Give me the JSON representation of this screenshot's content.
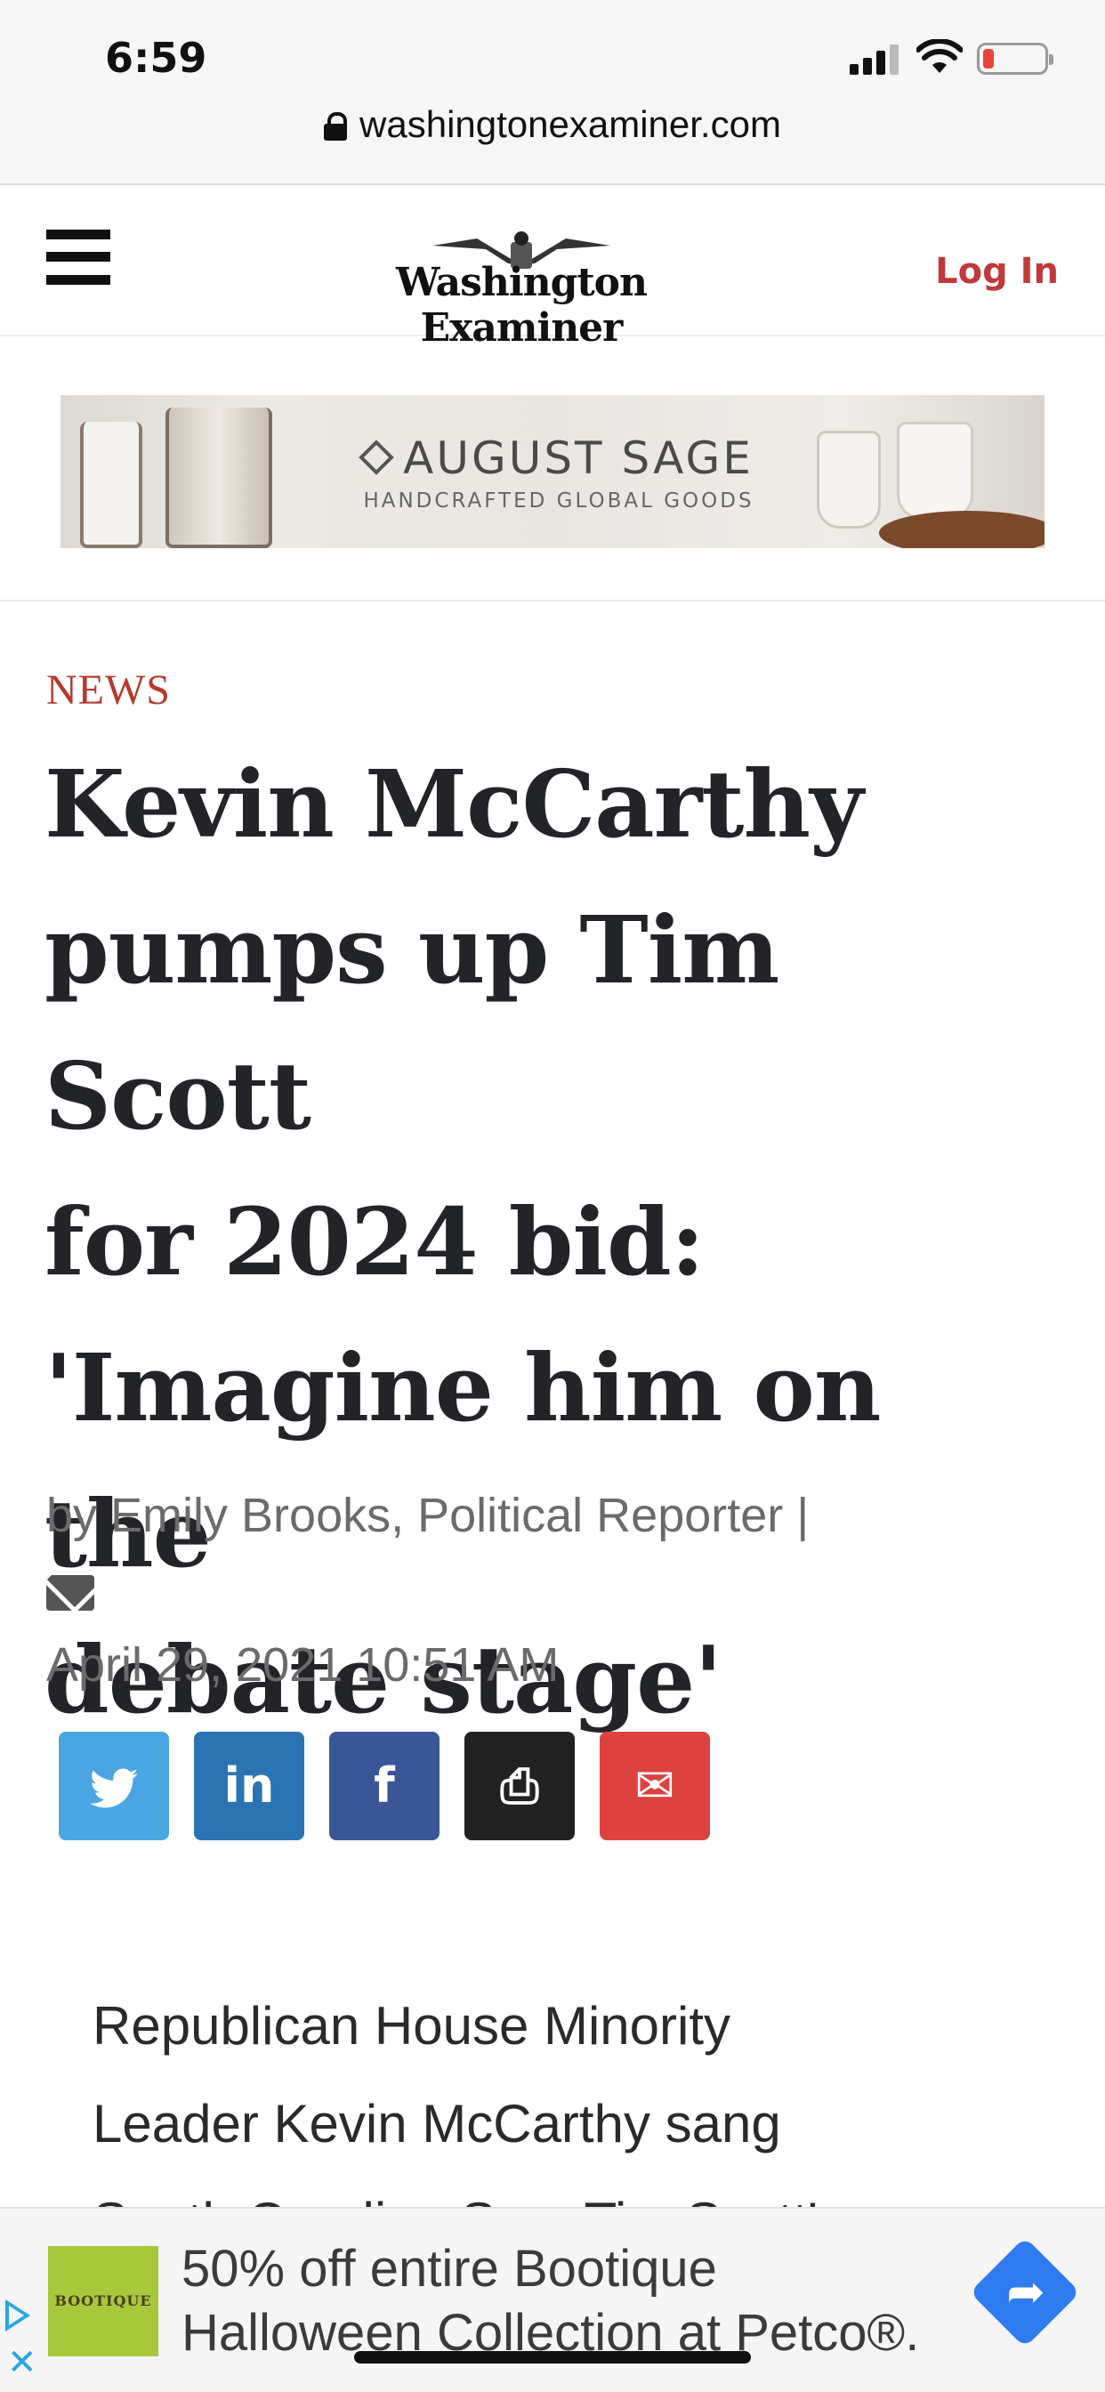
{
  "status_bar": {
    "time": "6:59",
    "url": "washingtonexaminer.com"
  },
  "header": {
    "logo_text": "Washington Examiner",
    "login_label": "Log In"
  },
  "top_ad": {
    "title": "AUGUST SAGE",
    "subtitle": "HANDCRAFTED GLOBAL GOODS"
  },
  "article": {
    "section": "NEWS",
    "headline_lines": [
      "Kevin McCarthy",
      "pumps up Tim Scott",
      "for 2024 bid:",
      "'Imagine him on the",
      "debate stage'"
    ],
    "byline": "by Emily Brooks, Political Reporter |",
    "date": "April 29, 2021 10:51 AM",
    "share_buttons": [
      {
        "name": "twitter",
        "glyph": "t",
        "color": "#4aa6e3"
      },
      {
        "name": "linkedin",
        "glyph": "in",
        "color": "#2a74b3"
      },
      {
        "name": "facebook",
        "glyph": "f",
        "color": "#3b5697"
      },
      {
        "name": "print",
        "glyph": "⎙",
        "color": "#222222"
      },
      {
        "name": "email",
        "glyph": "✉",
        "color": "#dc4340"
      }
    ],
    "body_lines": [
      "Republican House Minority",
      "Leader Kevin McCarthy sang",
      "South Carolina Sen. Tim Scott's"
    ]
  },
  "bottom_ad": {
    "logo_text": "BOOTIQUE",
    "copy_line1": "50% off entire Bootique",
    "copy_line2": "Halloween Collection at Petco®."
  },
  "colors": {
    "accent_red": "#c0393b",
    "section_red": "#b5392d",
    "text_dark": "#222428",
    "meta_gray": "#6b6b6b"
  }
}
